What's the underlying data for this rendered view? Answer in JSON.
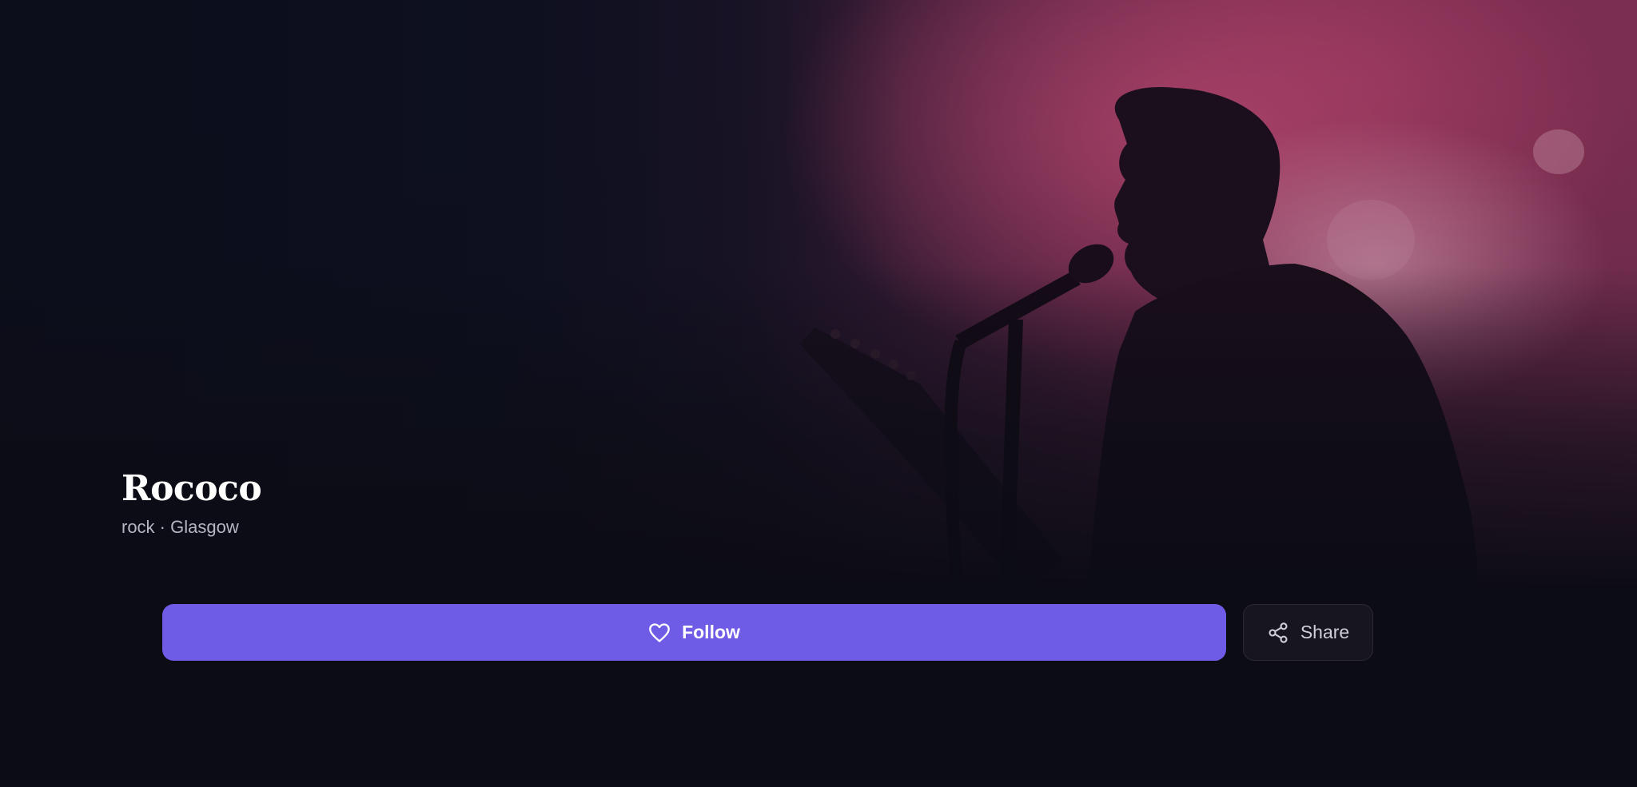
{
  "artist": {
    "name": "Rococo",
    "meta": "rock · Glasgow"
  },
  "actions": {
    "follow_label": "Follow",
    "follow_icon": "heart-icon",
    "share_label": "Share",
    "share_icon": "share-icon"
  },
  "colors": {
    "accent": "#6e5ce6",
    "background": "#0c0c15",
    "share_button_bg": "#17151f"
  }
}
